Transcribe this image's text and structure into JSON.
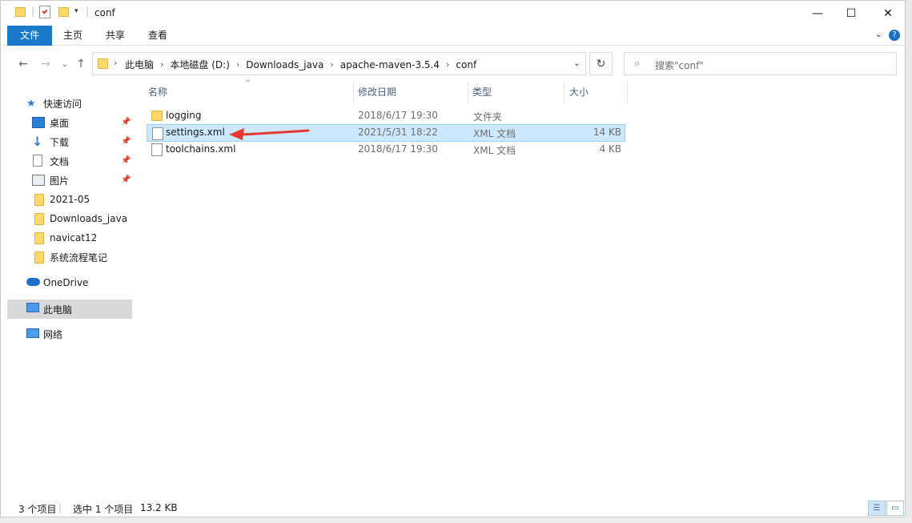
{
  "window": {
    "title": "conf"
  },
  "ribbon": {
    "tabs": [
      "文件",
      "主页",
      "共享",
      "查看"
    ]
  },
  "address": {
    "crumbs": [
      "此电脑",
      "本地磁盘 (D:)",
      "Downloads_java",
      "apache-maven-3.5.4",
      "conf"
    ]
  },
  "search": {
    "placeholder": "搜索\"conf\""
  },
  "sidebar": {
    "quick_access": "快速访问",
    "items": [
      {
        "label": "桌面",
        "icon": "desktop-icon",
        "pinned": true
      },
      {
        "label": "下载",
        "icon": "download-icon",
        "pinned": true
      },
      {
        "label": "文档",
        "icon": "documents-icon",
        "pinned": true
      },
      {
        "label": "图片",
        "icon": "pictures-icon",
        "pinned": true
      },
      {
        "label": "2021-05",
        "icon": "folder-icon",
        "pinned": false
      },
      {
        "label": "Downloads_java",
        "icon": "folder-icon",
        "pinned": false
      },
      {
        "label": "navicat12",
        "icon": "folder-icon",
        "pinned": false
      },
      {
        "label": "系统流程笔记",
        "icon": "folder-icon",
        "pinned": false
      }
    ],
    "onedrive": "OneDrive",
    "this_pc": "此电脑",
    "network": "网络"
  },
  "columns": {
    "name": "名称",
    "modified": "修改日期",
    "type": "类型",
    "size": "大小"
  },
  "files": [
    {
      "name": "logging",
      "modified": "2018/6/17 19:30",
      "type": "文件夹",
      "size": "",
      "kind": "folder",
      "selected": false
    },
    {
      "name": "settings.xml",
      "modified": "2021/5/31 18:22",
      "type": "XML 文档",
      "size": "14 KB",
      "kind": "file",
      "selected": true
    },
    {
      "name": "toolchains.xml",
      "modified": "2018/6/17 19:30",
      "type": "XML 文档",
      "size": "4 KB",
      "kind": "file",
      "selected": false
    }
  ],
  "status": {
    "count": "3 个项目",
    "selection": "选中 1 个项目",
    "size": "13.2 KB"
  },
  "colors": {
    "accent": "#1979ca",
    "selection_bg": "#cce8ff",
    "selection_border": "#99d1ff",
    "annotation_arrow": "#e53935"
  }
}
